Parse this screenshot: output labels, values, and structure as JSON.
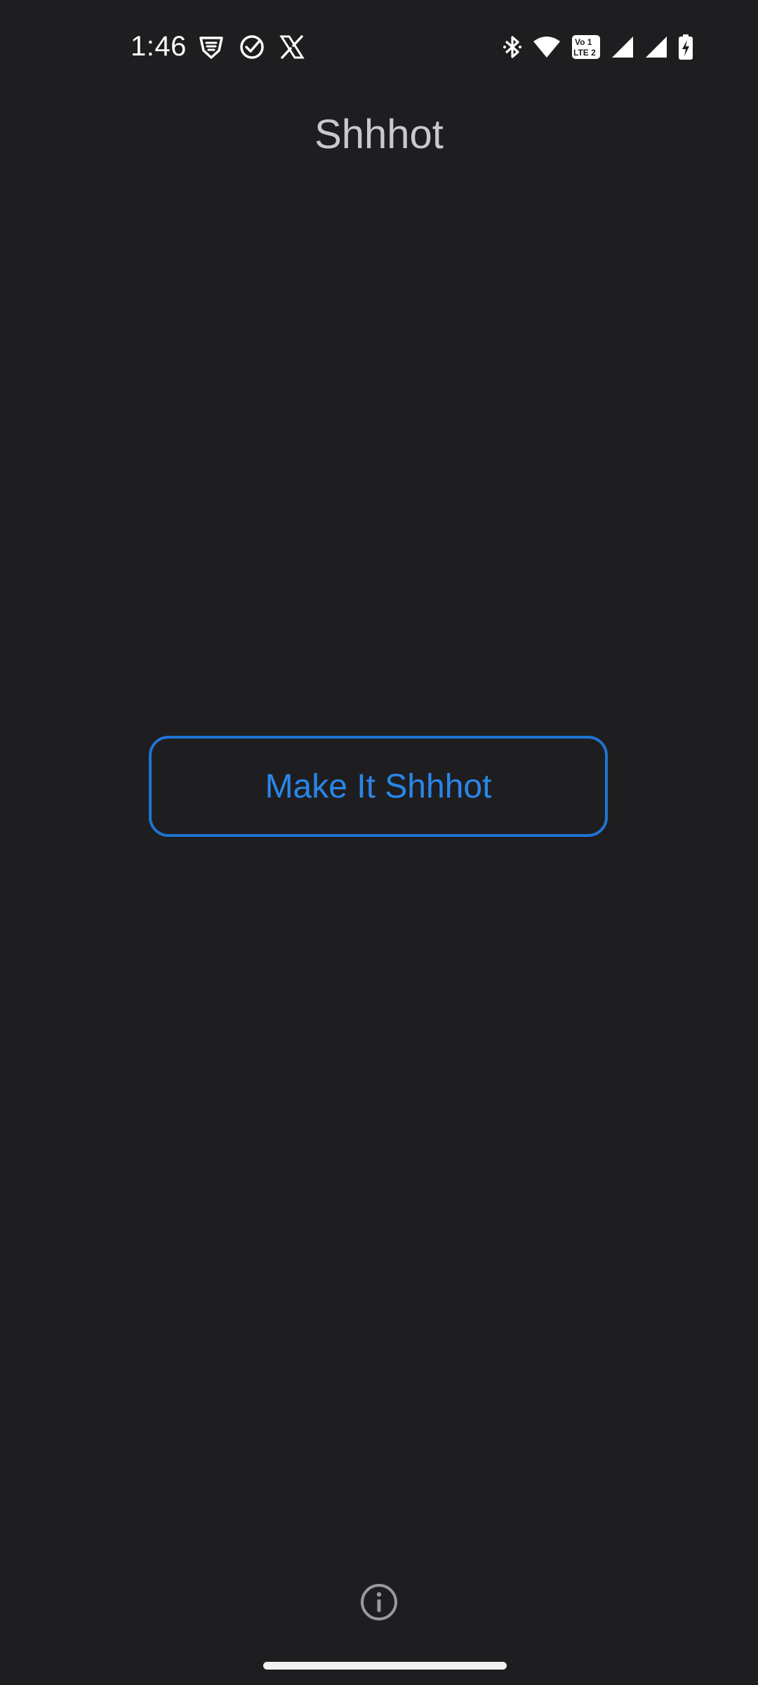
{
  "status_bar": {
    "time": "1:46",
    "left_icons": [
      "brave-shield-icon",
      "check-circle-icon",
      "x-logo-icon"
    ],
    "right_icons": [
      "bluetooth-icon",
      "wifi-icon",
      "volte-icon",
      "signal-icon",
      "signal-icon",
      "battery-charging-icon"
    ],
    "volte_text_top": "Vo 1",
    "volte_text_bottom": "LTE 2"
  },
  "header": {
    "title": "Shhhot"
  },
  "main": {
    "action_label": "Make It Shhhot"
  },
  "footer": {
    "info_icon": "info-icon"
  },
  "colors": {
    "background": "#1e1e20",
    "accent": "#2a86e8",
    "button_border": "#1f74d4",
    "title": "#c9c9cc"
  }
}
